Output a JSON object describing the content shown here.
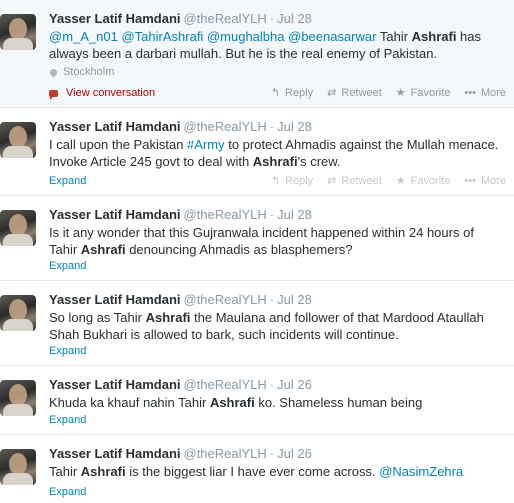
{
  "actions": {
    "reply": "Reply",
    "retweet": "Retweet",
    "favorite": "Favorite",
    "more": "More"
  },
  "icons": {
    "reply": "reply-icon",
    "retweet": "retweet-icon",
    "favorite": "star-icon",
    "more": "more-dots-icon",
    "location": "map-pin-icon",
    "conversation": "conversation-bubble-icon"
  },
  "colors": {
    "link": "#0084b4",
    "view_conversation": "#b00000",
    "muted": "#8899a6"
  },
  "tweets": [
    {
      "name": "Yasser Latif Hamdani",
      "handle": "@theRealYLH",
      "time": "Jul 28",
      "seg": [
        "@m_A_n01",
        " ",
        "@TahirAshrafi",
        " ",
        "@mughalbha",
        " ",
        "@beenasarwar",
        " Tahir ",
        "Ashrafi",
        " has always been a darbari mullah. But he is the real enemy of Pakistan."
      ],
      "location": "Stockholm",
      "footer_link": "View conversation"
    },
    {
      "name": "Yasser Latif Hamdani",
      "handle": "@theRealYLH",
      "time": "Jul 28",
      "seg": [
        "I call upon the Pakistan ",
        "#Army",
        " to protect Ahmadis against the Mullah menace. Invoke Article 245 govt to deal with ",
        "Ashrafi",
        "'s crew."
      ],
      "footer_link": "Expand"
    },
    {
      "name": "Yasser Latif Hamdani",
      "handle": "@theRealYLH",
      "time": "Jul 28",
      "seg": [
        "Is it any wonder that this Gujranwala incident happened within 24 hours of Tahir ",
        "Ashrafi",
        " denouncing Ahmadis as blasphemers?"
      ],
      "footer_link": "Expand"
    },
    {
      "name": "Yasser Latif Hamdani",
      "handle": "@theRealYLH",
      "time": "Jul 28",
      "seg": [
        "So long as Tahir ",
        "Ashrafi",
        " the Maulana and follower of that Mardood Ataullah Shah Bukhari is allowed to bark, such incidents will continue."
      ],
      "footer_link": "Expand"
    },
    {
      "name": "Yasser Latif Hamdani",
      "handle": "@theRealYLH",
      "time": "Jul 26",
      "seg": [
        "Khuda ka khauf nahin Tahir ",
        "Ashrafi",
        " ko. Shameless human being"
      ],
      "footer_link": "Expand"
    },
    {
      "name": "Yasser Latif Hamdani",
      "handle": "@theRealYLH",
      "time": "Jul 26",
      "seg": [
        "Tahir ",
        "Ashrafi",
        " is the biggest liar I have ever come across. ",
        "@NasimZehra"
      ],
      "footer_link": "Expand"
    }
  ]
}
